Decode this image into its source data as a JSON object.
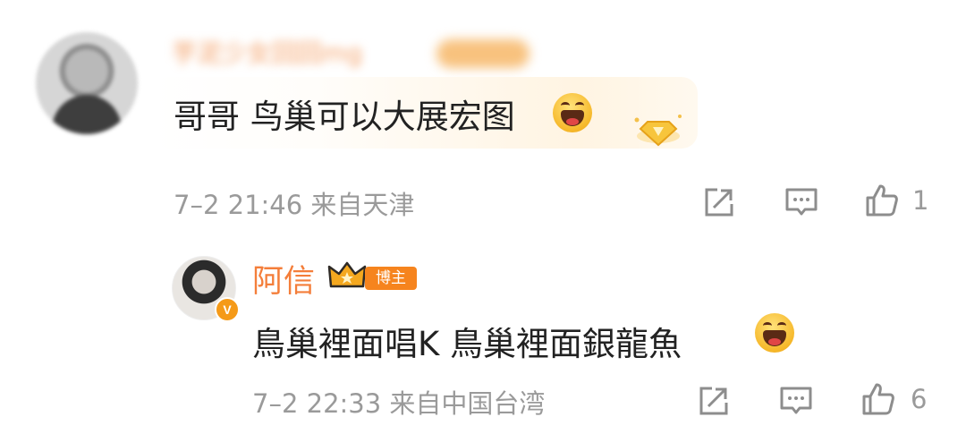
{
  "comment": {
    "username": "芋泥少女回回mg",
    "text": "哥哥 鸟巢可以大展宏图",
    "emoji": "laughing-emoji",
    "meta": "7–2 21:46 来自天津",
    "like_count": "1"
  },
  "reply": {
    "username": "阿信",
    "badge_label": "博主",
    "verified": "V",
    "text": "鳥巢裡面唱K 鳥巢裡面銀龍魚",
    "emoji": "laughing-emoji",
    "meta": "7–2 22:33 来自中国台湾",
    "like_count": "6"
  },
  "icons": {
    "share": "share-icon",
    "comment": "comment-icon",
    "like": "thumbs-up-icon"
  },
  "colors": {
    "username": "#f47e3a",
    "meta": "#9a9a9a",
    "blogger_badge": "#f6841e"
  }
}
